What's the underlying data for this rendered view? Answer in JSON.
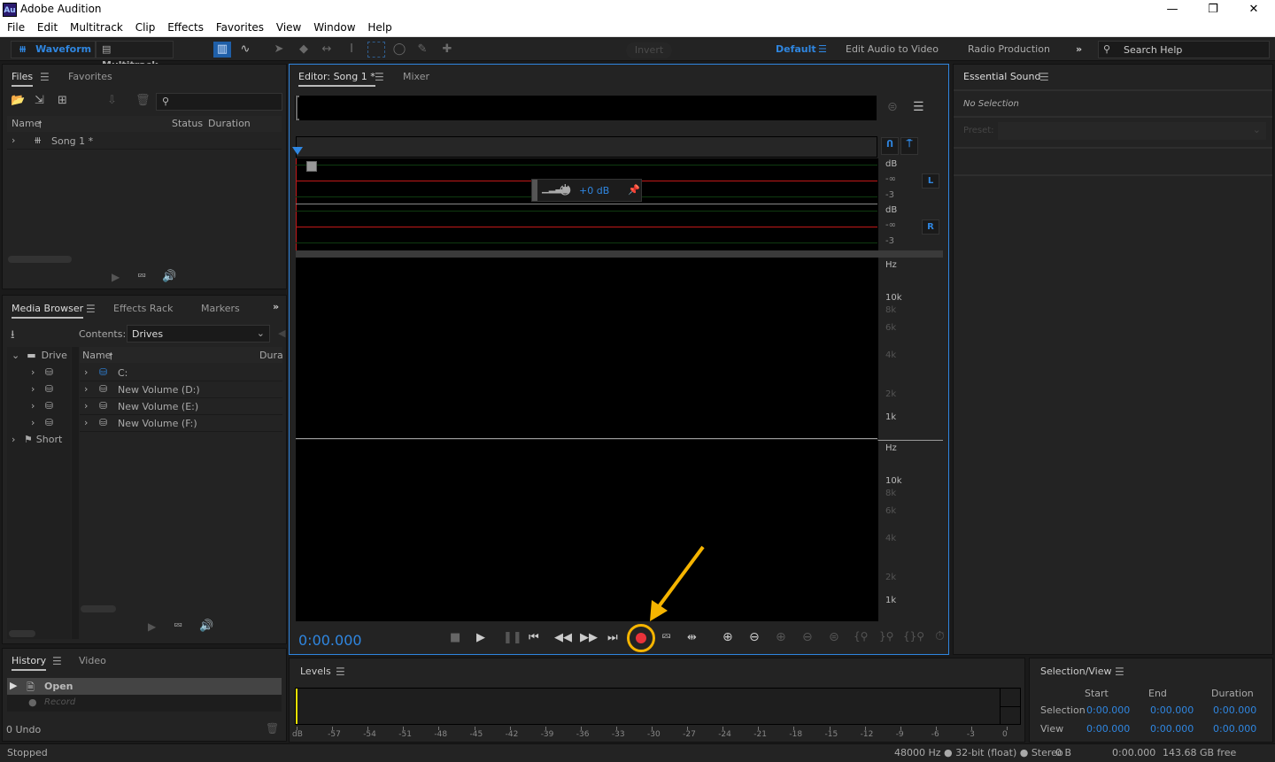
{
  "window": {
    "app_icon_label": "Au",
    "title": "Adobe Audition",
    "minimize_glyph": "—",
    "maximize_glyph": "❐",
    "close_glyph": "✕"
  },
  "menu": [
    "File",
    "Edit",
    "Multitrack",
    "Clip",
    "Effects",
    "Favorites",
    "View",
    "Window",
    "Help"
  ],
  "toolbar": {
    "waveform_label": "Waveform",
    "multitrack_label": "Multitrack",
    "invert_label": "Invert",
    "workspaces": {
      "active": "Default",
      "others": [
        "Edit Audio to Video",
        "Radio Production"
      ],
      "more_glyph": "»"
    },
    "search_placeholder": "Search Help"
  },
  "files_panel": {
    "tabs": [
      "Files",
      "Favorites"
    ],
    "columns": [
      "Name",
      "Status",
      "Duration"
    ],
    "sort_glyph": "🠕",
    "items": [
      {
        "name": "Song 1 *"
      }
    ]
  },
  "media_browser": {
    "tabs": [
      "Media Browser",
      "Effects Rack",
      "Markers"
    ],
    "more_glyph": "»",
    "contents_label": "Contents:",
    "contents_value": "Drives",
    "tree": [
      {
        "label": "Drives"
      },
      {
        "label": "C:"
      },
      {
        "label": "New Volume (D:)"
      },
      {
        "label": "New Volume (E:)"
      },
      {
        "label": "New Volume (F:)"
      },
      {
        "label": "Shortcuts"
      }
    ],
    "tree_visible": [
      "Drive",
      "",
      "",
      "",
      "",
      "Short"
    ],
    "columns": [
      "Name",
      "Dura"
    ],
    "items": [
      "C:",
      "New Volume (D:)",
      "New Volume (E:)",
      "New Volume (F:)"
    ]
  },
  "history_panel": {
    "tabs": [
      "History",
      "Video"
    ],
    "items": [
      {
        "label": "Open",
        "state": "active"
      },
      {
        "label": "Record",
        "state": "disabled"
      }
    ],
    "undo_count": "0 Undo"
  },
  "editor": {
    "tabs": [
      "Editor: Song 1 *",
      "Mixer"
    ],
    "hud_gain": "+0 dB",
    "channels": [
      {
        "id": "L",
        "db_labels": [
          "dB",
          "-∞",
          "-3"
        ]
      },
      {
        "id": "R",
        "db_labels": [
          "dB",
          "-∞",
          "-3"
        ]
      }
    ],
    "spectral_labels": [
      "Hz",
      "10k",
      "8k",
      "6k",
      "4k",
      "2k",
      "1k"
    ],
    "time": "0:00.000"
  },
  "essential_sound": {
    "title": "Essential Sound",
    "no_selection": "No Selection",
    "preset_label": "Preset:",
    "preset_value": ""
  },
  "levels": {
    "title": "Levels",
    "ticks": [
      "dB",
      "-57",
      "-54",
      "-51",
      "-48",
      "-45",
      "-42",
      "-39",
      "-36",
      "-33",
      "-30",
      "-27",
      "-24",
      "-21",
      "-18",
      "-15",
      "-12",
      "-9",
      "-6",
      "-3",
      "0"
    ]
  },
  "selection_view": {
    "title": "Selection/View",
    "columns": [
      "Start",
      "End",
      "Duration"
    ],
    "rows": [
      {
        "label": "Selection",
        "values": [
          "0:00.000",
          "0:00.000",
          "0:00.000"
        ]
      },
      {
        "label": "View",
        "values": [
          "0:00.000",
          "0:00.000",
          "0:00.000"
        ]
      }
    ]
  },
  "status_bar": {
    "state": "Stopped",
    "format": "48000 Hz ● 32-bit (float) ● Stereo",
    "size": "0 B",
    "duration": "0:00.000",
    "free": "143.68 GB free"
  },
  "colors": {
    "accent": "#2f86e0",
    "record": "#e8333a",
    "annotation": "#f5b400",
    "meter_red": "#c01818",
    "meter_green": "#0f3a10"
  }
}
